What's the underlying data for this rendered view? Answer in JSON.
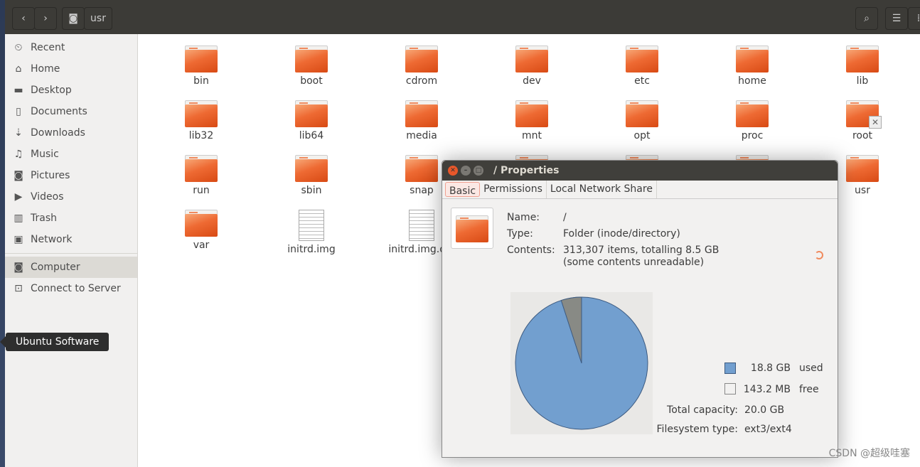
{
  "header": {
    "back": "‹",
    "forward": "›",
    "path": "usr"
  },
  "sidebar": {
    "items": [
      {
        "label": "Recent",
        "icon": "⏲",
        "name": "recent"
      },
      {
        "label": "Home",
        "icon": "⌂",
        "name": "home"
      },
      {
        "label": "Desktop",
        "icon": "▬",
        "name": "desktop"
      },
      {
        "label": "Documents",
        "icon": "▯",
        "name": "documents"
      },
      {
        "label": "Downloads",
        "icon": "⇣",
        "name": "downloads"
      },
      {
        "label": "Music",
        "icon": "♫",
        "name": "music"
      },
      {
        "label": "Pictures",
        "icon": "◙",
        "name": "pictures"
      },
      {
        "label": "Videos",
        "icon": "▶",
        "name": "videos"
      },
      {
        "label": "Trash",
        "icon": "▥",
        "name": "trash"
      },
      {
        "label": "Network",
        "icon": "▣",
        "name": "network"
      }
    ],
    "computer": "Computer",
    "connect": "Connect to Server"
  },
  "tooltip": "Ubuntu Software",
  "files": [
    {
      "label": "bin",
      "type": "folder"
    },
    {
      "label": "boot",
      "type": "folder"
    },
    {
      "label": "cdrom",
      "type": "folder"
    },
    {
      "label": "dev",
      "type": "folder"
    },
    {
      "label": "etc",
      "type": "folder"
    },
    {
      "label": "home",
      "type": "folder"
    },
    {
      "label": "lib",
      "type": "folder"
    },
    {
      "label": "lib32",
      "type": "folder"
    },
    {
      "label": "lib64",
      "type": "folder"
    },
    {
      "label": "media",
      "type": "folder"
    },
    {
      "label": "mnt",
      "type": "folder"
    },
    {
      "label": "opt",
      "type": "folder"
    },
    {
      "label": "proc",
      "type": "folder"
    },
    {
      "label": "root",
      "type": "folder-locked"
    },
    {
      "label": "run",
      "type": "folder"
    },
    {
      "label": "sbin",
      "type": "folder"
    },
    {
      "label": "snap",
      "type": "folder"
    },
    {
      "label": "",
      "type": "folder"
    },
    {
      "label": "",
      "type": "folder"
    },
    {
      "label": "",
      "type": "folder"
    },
    {
      "label": "usr",
      "type": "folder"
    },
    {
      "label": "var",
      "type": "folder"
    },
    {
      "label": "initrd.img",
      "type": "file"
    },
    {
      "label": "initrd.img.old",
      "type": "file"
    }
  ],
  "dialog": {
    "title": "/ Properties",
    "tabs": [
      "Basic",
      "Permissions",
      "Local Network Share"
    ],
    "name_label": "Name:",
    "name": "/",
    "type_label": "Type:",
    "type": "Folder (inode/directory)",
    "contents_label": "Contents:",
    "contents": "313,307 items, totalling 8.5 GB",
    "contents_note": "(some contents unreadable)",
    "used": "18.8 GB",
    "used_label": "used",
    "free": "143.2 MB",
    "free_label": "free",
    "capacity_label": "Total capacity:",
    "capacity": "20.0 GB",
    "fs_label": "Filesystem type:",
    "fs": "ext3/ext4",
    "used_fraction": 0.95,
    "used_color": "#729fcf",
    "free_color": "#888a85"
  },
  "watermark": "CSDN @超级哇塞"
}
